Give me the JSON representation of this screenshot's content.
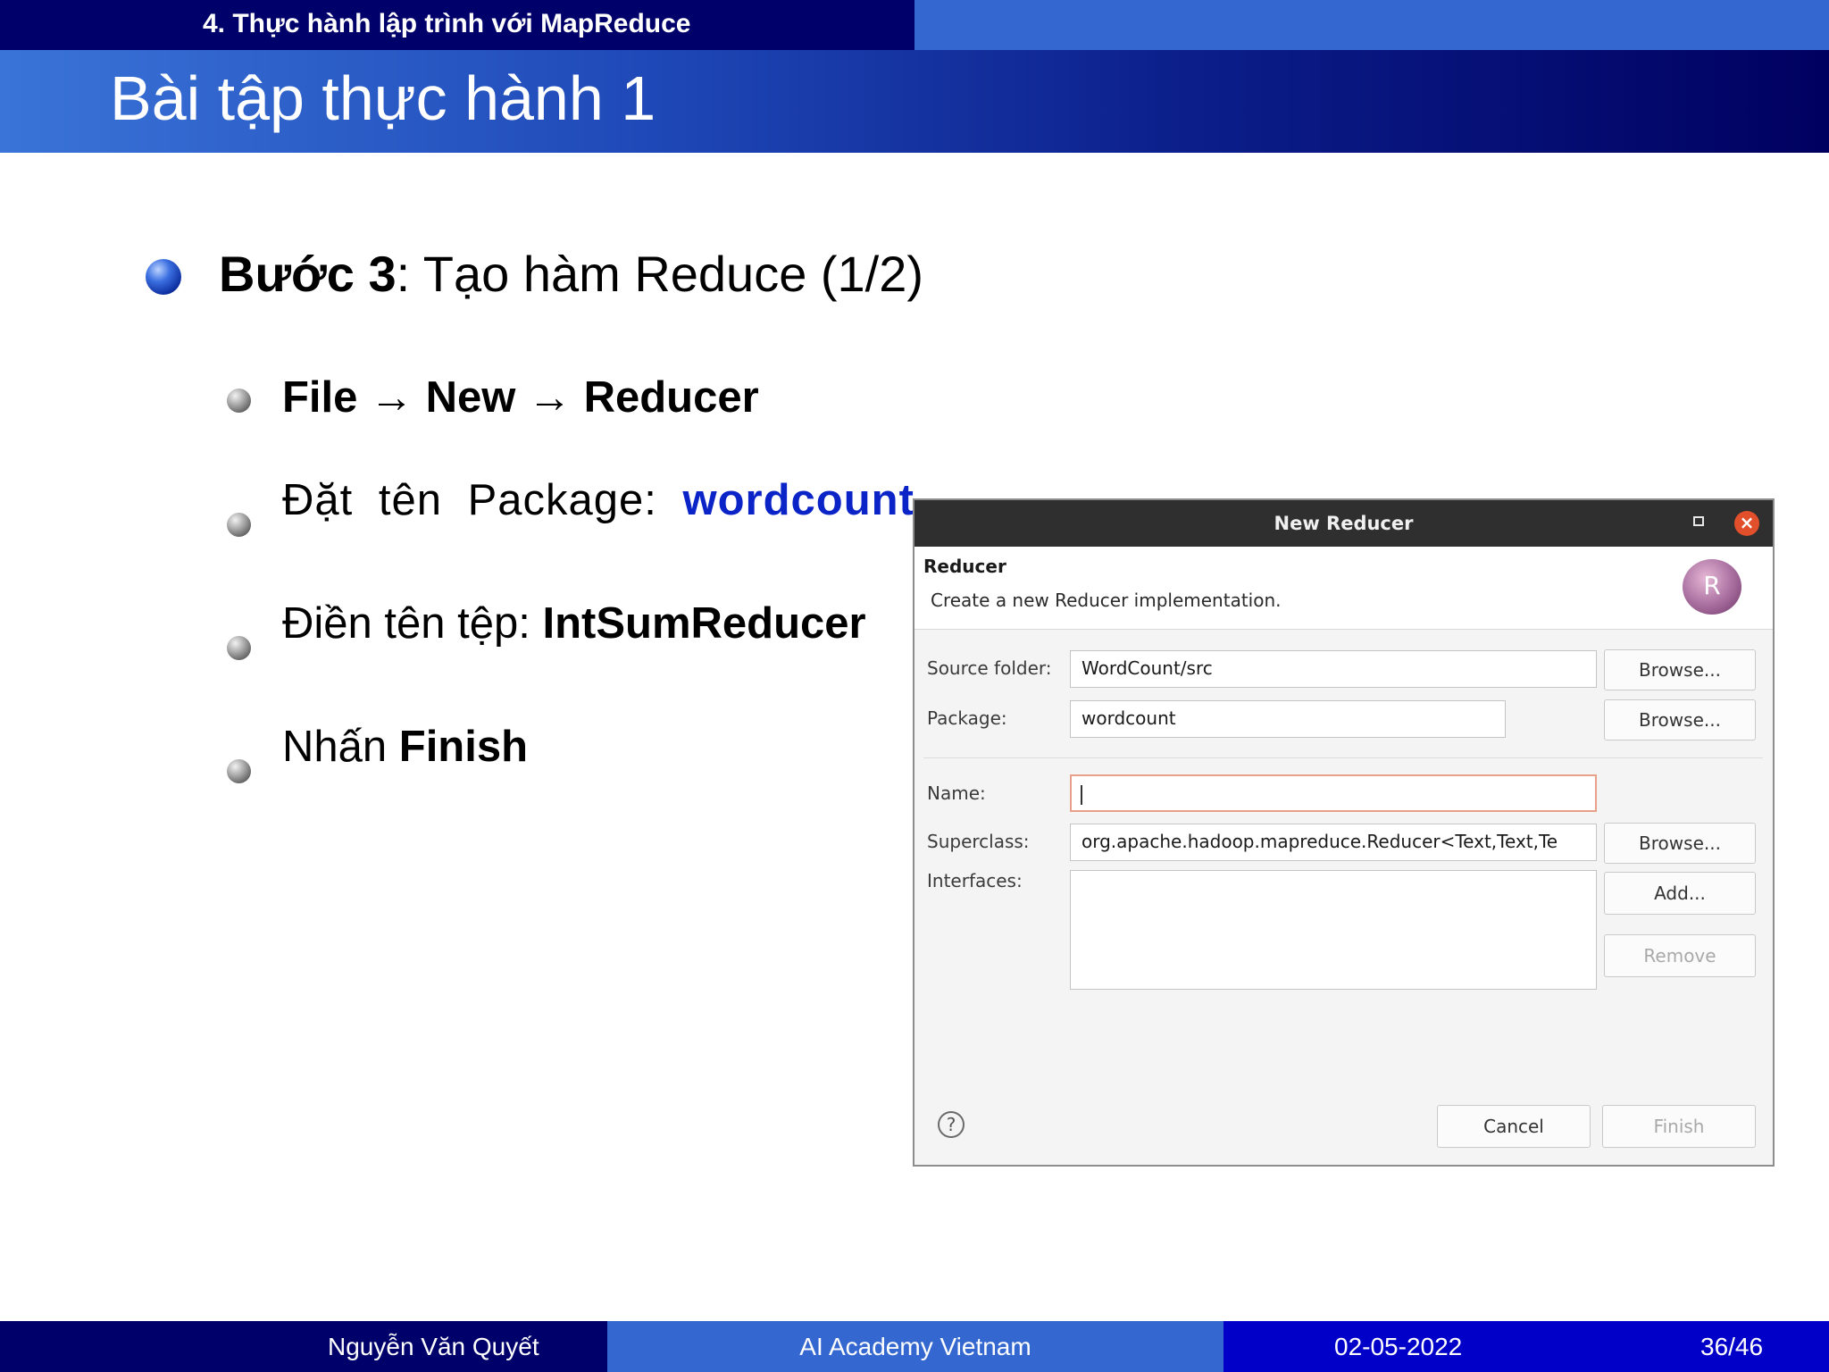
{
  "header": {
    "section": "4. Thực hành lập trình với MapReduce",
    "title": "Bài tập thực hành 1"
  },
  "content": {
    "step_bold": "Bước 3",
    "step_rest": ": Tạo hàm Reduce (1/2)",
    "bullets": {
      "menu_path": "File → New → Reducer",
      "package_prefix": "Đặt tên Package: ",
      "package_value": "wordcount",
      "file_prefix": "Điền tên tệp: ",
      "file_value": "IntSumReducer",
      "finish_prefix": "Nhấn ",
      "finish_value": "Finish"
    }
  },
  "dialog": {
    "title": "New Reducer",
    "heading": "Reducer",
    "description": "Create a new Reducer implementation.",
    "logo_letter": "R",
    "labels": {
      "source_folder": "Source folder:",
      "package": "Package:",
      "name": "Name:",
      "superclass": "Superclass:",
      "interfaces": "Interfaces:"
    },
    "values": {
      "source_folder": "WordCount/src",
      "package": "wordcount",
      "name": "",
      "superclass": "org.apache.hadoop.mapreduce.Reducer<Text,Text,Te"
    },
    "buttons": {
      "browse": "Browse...",
      "add": "Add...",
      "remove": "Remove",
      "cancel": "Cancel",
      "finish": "Finish"
    },
    "help_glyph": "?",
    "close_glyph": "×"
  },
  "footer": {
    "author": "Nguyễn Văn Quyết",
    "org": "AI Academy Vietnam",
    "date": "02-05-2022",
    "page": "36/46"
  },
  "colors": {
    "navy": "#00006a",
    "mid_blue": "#3467d0",
    "bright_blue": "#0000c8",
    "accent_text": "#0a24c8",
    "dialog_titlebar": "#2f2f2f",
    "close_red": "#e1502b"
  }
}
